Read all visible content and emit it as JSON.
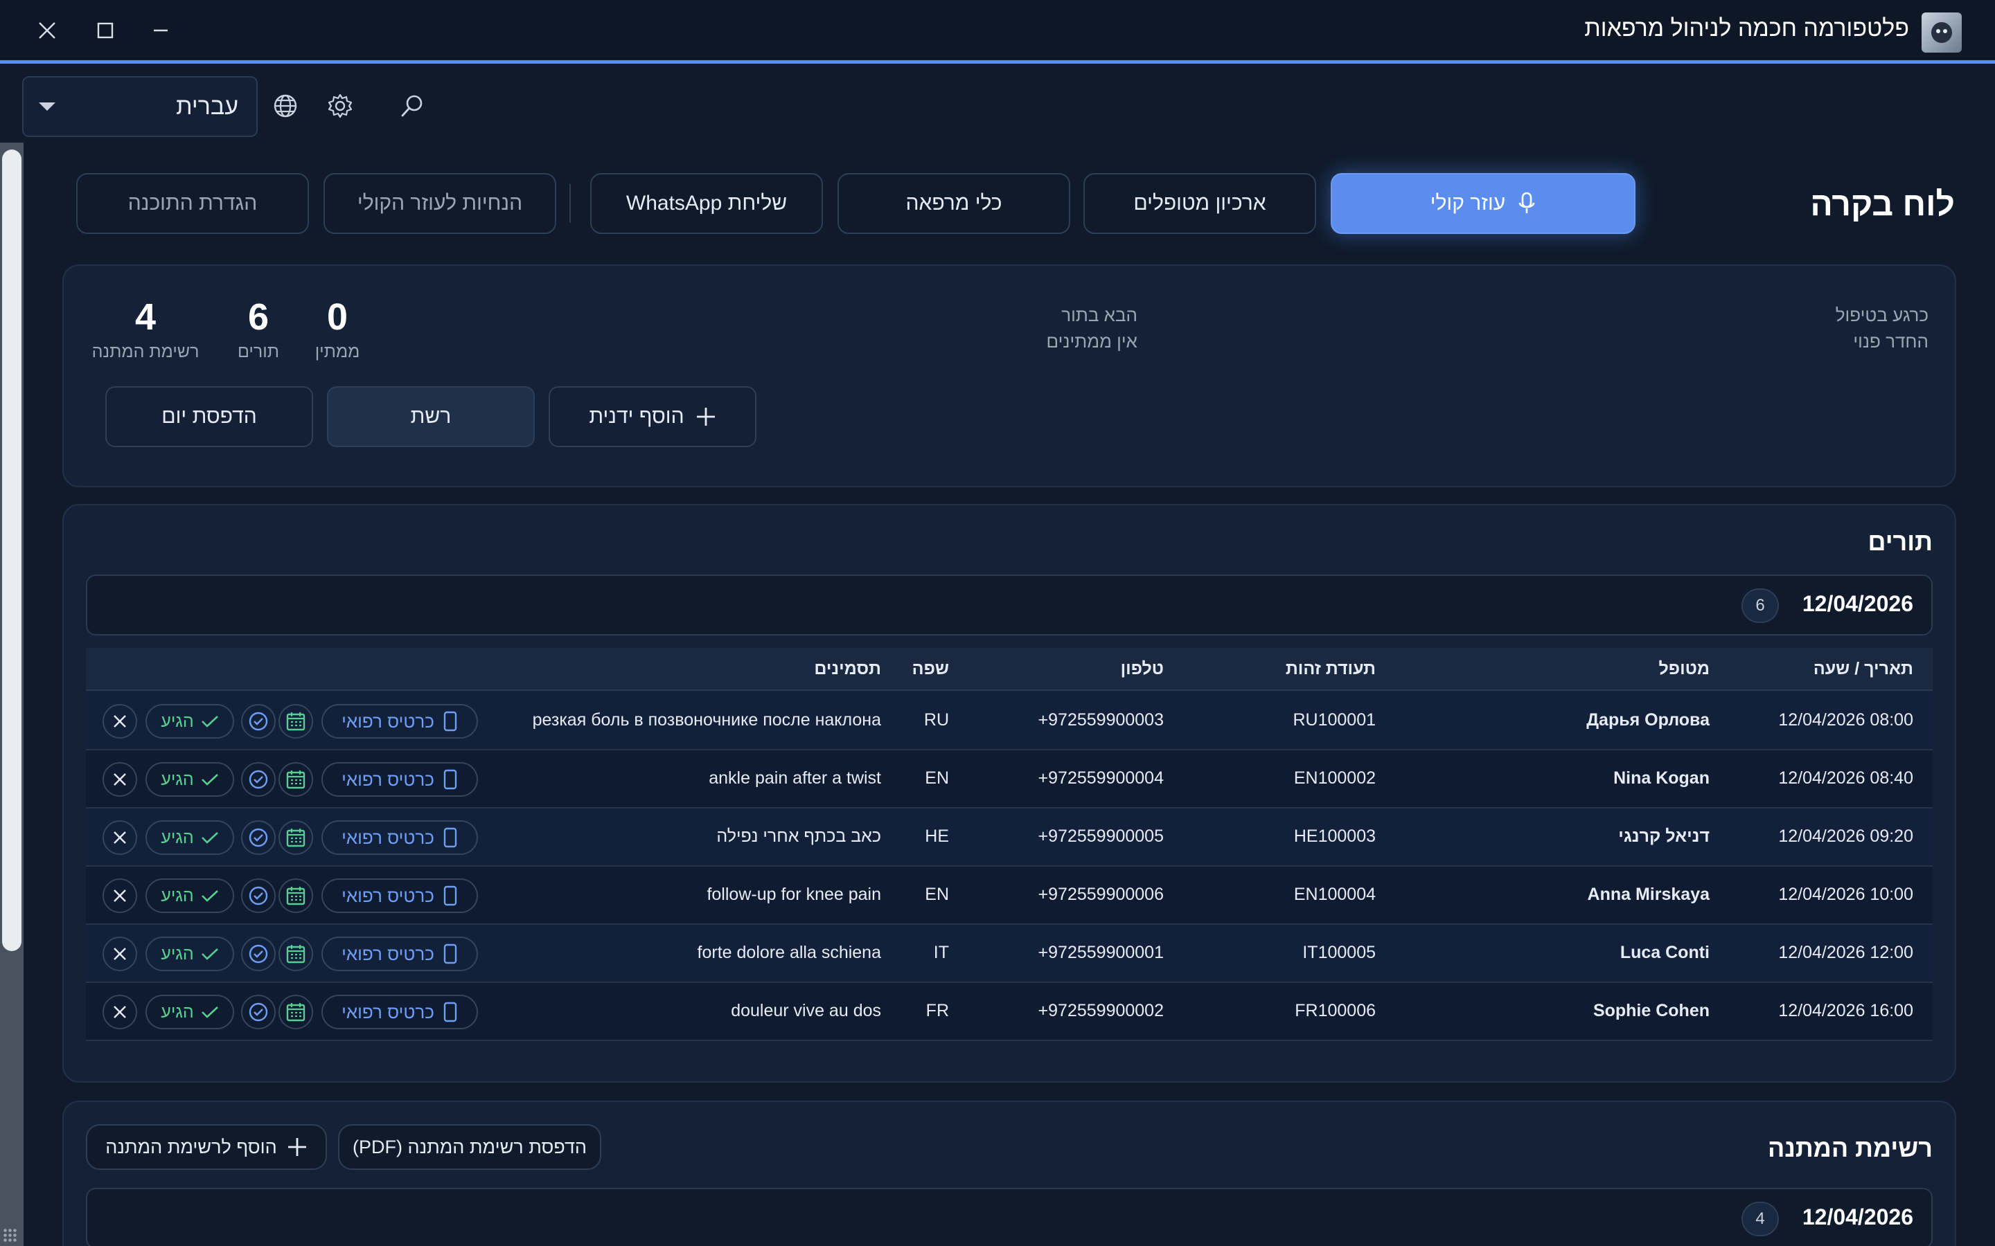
{
  "window": {
    "title": "פלטפורמה חכמה לניהול מרפאות",
    "icons": [
      "app-logo",
      "close-icon",
      "maximize-icon",
      "minimize-icon"
    ]
  },
  "toolbar": {
    "language": "עברית",
    "icons": [
      "chevron-down-icon",
      "globe-icon",
      "gear-icon",
      "search-icon"
    ]
  },
  "page": {
    "heading": "לוח בקרה"
  },
  "nav": {
    "voice_assistant": "עוזר קולי",
    "patient_archive": "ארכיון מטופלים",
    "clinic_tools": "כלי מרפאה",
    "send_whatsapp": "שליחת WhatsApp",
    "voice_guidelines": "הנחיות לעוזר הקולי",
    "app_setup": "הגדרת התוכנה"
  },
  "summary": {
    "current_label": "כרגע בטיפול",
    "current_value": "החדר פנוי",
    "next_label": "הבא בתור",
    "next_value": "אין ממתינים",
    "stats": [
      {
        "value": "4",
        "label": "רשימת המתנה"
      },
      {
        "value": "6",
        "label": "תורים"
      },
      {
        "value": "0",
        "label": "ממתין"
      }
    ],
    "buttons": {
      "add_manual": "הוסף ידנית",
      "network": "רשת",
      "print_day": "הדפסת יום"
    }
  },
  "appointments": {
    "title": "תורים",
    "date": "12/04/2026",
    "count": "6",
    "headers": {
      "datetime": "תאריך / שעה",
      "patient": "מטופל",
      "id": "תעודת זהות",
      "phone": "טלפון",
      "language": "שפה",
      "symptoms": "תסמינים"
    },
    "row_actions": {
      "medical_card": "כרטיס רפואי",
      "arrived": "הגיע"
    },
    "rows": [
      {
        "datetime": "12/04/2026 08:00",
        "patient": "Дарья Орлова",
        "id": "RU100001",
        "phone": "+972559900003",
        "language": "RU",
        "symptoms": "резкая боль в позвоночнике после наклона"
      },
      {
        "datetime": "12/04/2026 08:40",
        "patient": "Nina Kogan",
        "id": "EN100002",
        "phone": "+972559900004",
        "language": "EN",
        "symptoms": "ankle pain after a twist"
      },
      {
        "datetime": "12/04/2026 09:20",
        "patient": "דניאל קרנגי",
        "id": "HE100003",
        "phone": "+972559900005",
        "language": "HE",
        "symptoms": "כאב בכתף אחרי נפילה"
      },
      {
        "datetime": "12/04/2026 10:00",
        "patient": "Anna Mirskaya",
        "id": "EN100004",
        "phone": "+972559900006",
        "language": "EN",
        "symptoms": "follow-up for knee pain"
      },
      {
        "datetime": "12/04/2026 12:00",
        "patient": "Luca Conti",
        "id": "IT100005",
        "phone": "+972559900001",
        "language": "IT",
        "symptoms": "forte dolore alla schiena"
      },
      {
        "datetime": "12/04/2026 16:00",
        "patient": "Sophie Cohen",
        "id": "FR100006",
        "phone": "+972559900002",
        "language": "FR",
        "symptoms": "douleur vive au dos"
      }
    ]
  },
  "waitlist": {
    "title": "רשימת המתנה",
    "print_pdf": "הדפסת רשימת המתנה (PDF)",
    "add": "הוסף לרשימת המתנה",
    "date": "12/04/2026",
    "count": "4"
  },
  "colors": {
    "background": "#0f1a2b",
    "accent": "#5b8def",
    "success": "#58d08f",
    "link": "#6f9ff5"
  }
}
